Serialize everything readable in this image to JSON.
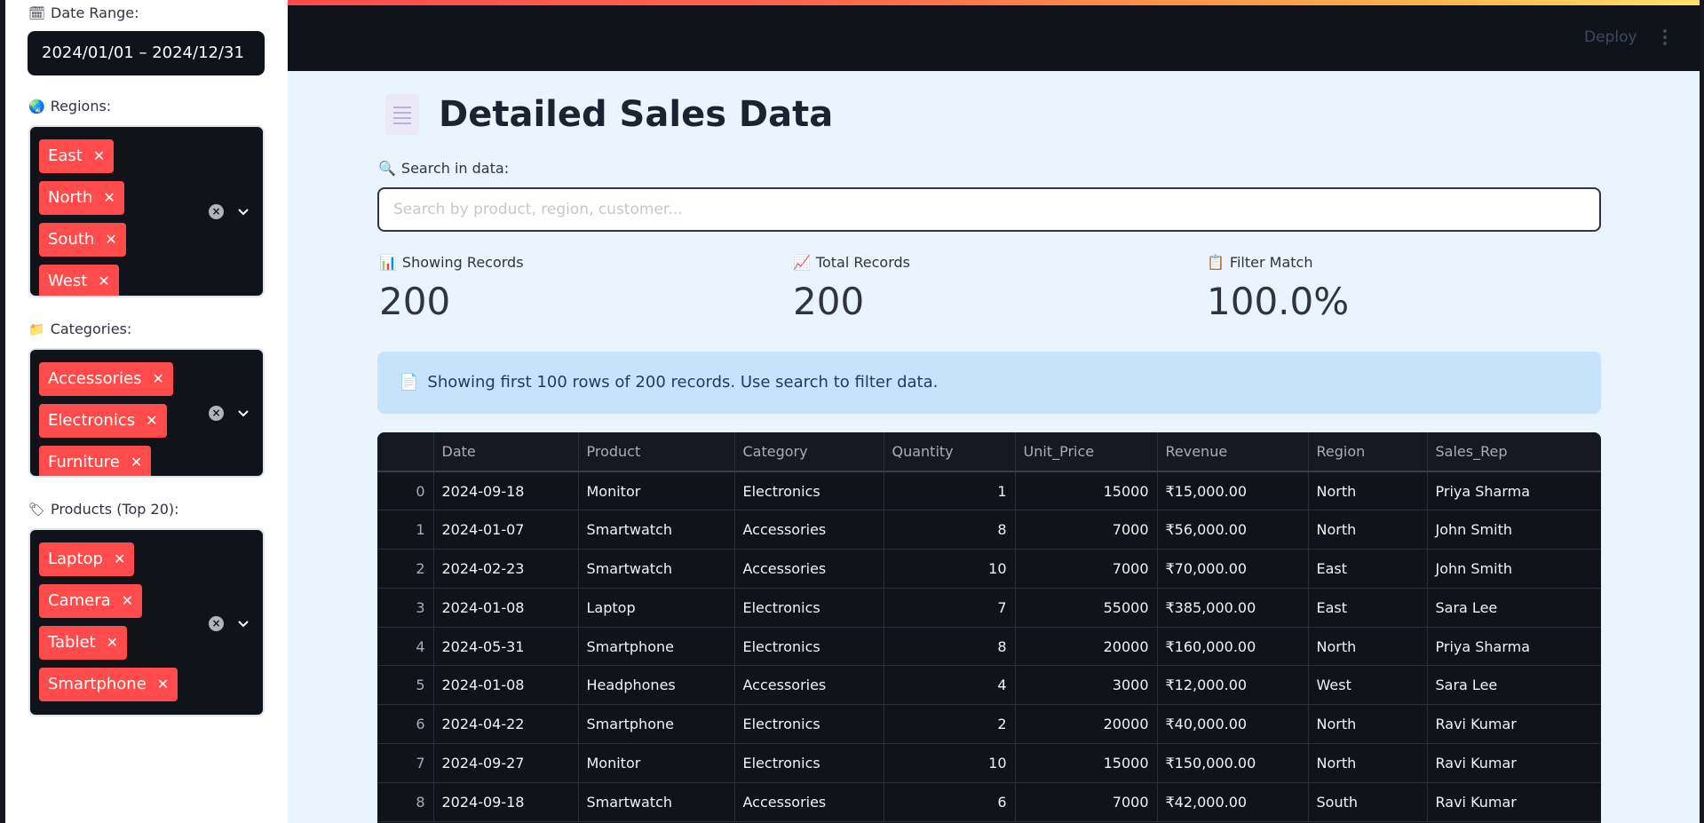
{
  "sidebar": {
    "date_range": {
      "label": "Date Range:",
      "value": "2024/01/01 – 2024/12/31"
    },
    "regions": {
      "label": "Regions:",
      "selected": [
        "East",
        "North",
        "South",
        "West"
      ]
    },
    "categories": {
      "label": "Categories:",
      "selected": [
        "Accessories",
        "Electronics",
        "Furniture"
      ]
    },
    "products": {
      "label": "Products (Top 20):",
      "selected": [
        "Laptop",
        "Camera",
        "Tablet",
        "Smartphone"
      ]
    }
  },
  "topbar": {
    "deploy_label": "Deploy"
  },
  "main": {
    "title": "Detailed Sales Data",
    "search": {
      "label": "Search in data:",
      "placeholder": "Search by product, region, customer..."
    },
    "metrics": [
      {
        "icon": "📊",
        "label": "Showing Records",
        "value": "200"
      },
      {
        "icon": "📈",
        "label": "Total Records",
        "value": "200"
      },
      {
        "icon": "📋",
        "label": "Filter Match",
        "value": "100.0%"
      }
    ],
    "info_text": "Showing first 100 rows of 200 records. Use search to filter data.",
    "table": {
      "columns": [
        "",
        "Date",
        "Product",
        "Category",
        "Quantity",
        "Unit_Price",
        "Revenue",
        "Region",
        "Sales_Rep"
      ],
      "rows": [
        [
          "0",
          "2024-09-18",
          "Monitor",
          "Electronics",
          "1",
          "15000",
          "₹15,000.00",
          "North",
          "Priya Sharma"
        ],
        [
          "1",
          "2024-01-07",
          "Smartwatch",
          "Accessories",
          "8",
          "7000",
          "₹56,000.00",
          "North",
          "John Smith"
        ],
        [
          "2",
          "2024-02-23",
          "Smartwatch",
          "Accessories",
          "10",
          "7000",
          "₹70,000.00",
          "East",
          "John Smith"
        ],
        [
          "3",
          "2024-01-08",
          "Laptop",
          "Electronics",
          "7",
          "55000",
          "₹385,000.00",
          "East",
          "Sara Lee"
        ],
        [
          "4",
          "2024-05-31",
          "Smartphone",
          "Electronics",
          "8",
          "20000",
          "₹160,000.00",
          "North",
          "Priya Sharma"
        ],
        [
          "5",
          "2024-01-08",
          "Headphones",
          "Accessories",
          "4",
          "3000",
          "₹12,000.00",
          "West",
          "Sara Lee"
        ],
        [
          "6",
          "2024-04-22",
          "Smartphone",
          "Electronics",
          "2",
          "20000",
          "₹40,000.00",
          "North",
          "Ravi Kumar"
        ],
        [
          "7",
          "2024-09-27",
          "Monitor",
          "Electronics",
          "10",
          "15000",
          "₹150,000.00",
          "North",
          "Ravi Kumar"
        ],
        [
          "8",
          "2024-09-18",
          "Smartwatch",
          "Accessories",
          "6",
          "7000",
          "₹42,000.00",
          "South",
          "Ravi Kumar"
        ]
      ]
    }
  },
  "colors": {
    "accent": "#ff4b4b",
    "dark": "#10131a",
    "main_bg": "#e9f4fd",
    "info_bg": "#c7e3fb"
  }
}
